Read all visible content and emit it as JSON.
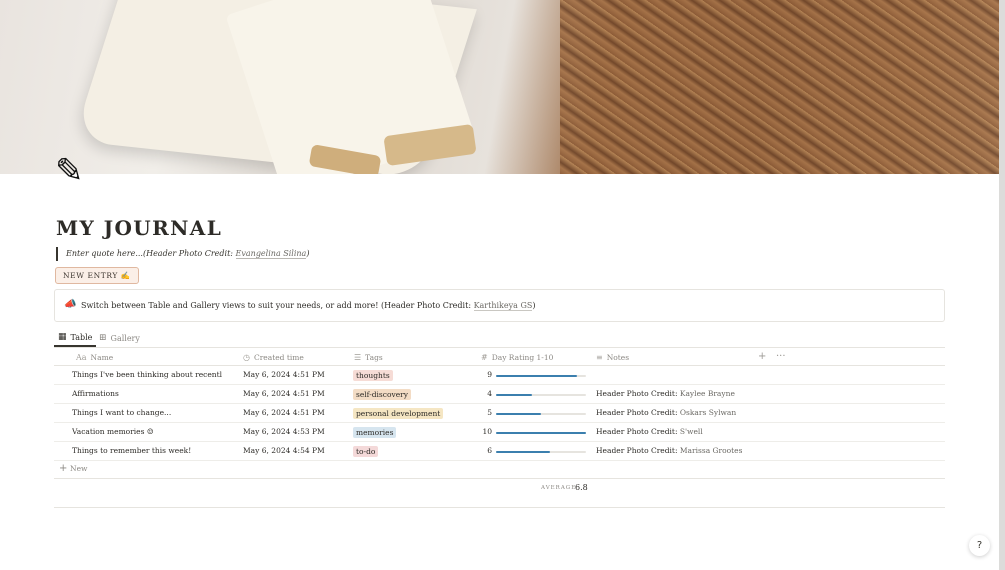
{
  "page": {
    "icon": "pencil-icon",
    "title": "MY JOURNAL",
    "quote_text": "Enter quote here...(Header Photo Credit: ",
    "quote_author": "Evangelina Silina",
    "quote_end": ")",
    "new_entry_label": "NEW ENTRY ✍"
  },
  "callout": {
    "icon": "megaphone-icon",
    "text": "Switch between Table and Gallery views to suit your needs, or add more! (Header Photo Credit: ",
    "credit": "Karthikeya GS",
    "end": ")"
  },
  "views": [
    {
      "label": "Table",
      "icon": "table-icon",
      "active": true
    },
    {
      "label": "Gallery",
      "icon": "gallery-icon",
      "active": false
    }
  ],
  "columns": [
    {
      "label": "Name",
      "icon": "text-icon"
    },
    {
      "label": "Created time",
      "icon": "clock-icon"
    },
    {
      "label": "Tags",
      "icon": "list-icon"
    },
    {
      "label": "Day Rating 1-10",
      "icon": "hash-icon"
    },
    {
      "label": "Notes",
      "icon": "lines-icon"
    }
  ],
  "rows": [
    {
      "name": "Things I've been thinking about recently...",
      "created": "May 6, 2024 4:51 PM",
      "tag": "thoughts",
      "tag_color": "#f6dcd6",
      "rating": 9,
      "notes_prefix": "",
      "notes_author": ""
    },
    {
      "name": "Affirmations",
      "created": "May 6, 2024 4:51 PM",
      "tag": "self-discovery",
      "tag_color": "#f3dcc5",
      "rating": 4,
      "notes_prefix": "Header Photo Credit: ",
      "notes_author": "Kaylee Brayne"
    },
    {
      "name": "Things I want to change...",
      "created": "May 6, 2024 4:51 PM",
      "tag": "personal development",
      "tag_color": "#f5e6c3",
      "rating": 5,
      "notes_prefix": "Header Photo Credit: ",
      "notes_author": "Oskars Sylwan"
    },
    {
      "name": "Vacation memories ☺",
      "created": "May 6, 2024 4:53 PM",
      "tag": "memories",
      "tag_color": "#d6e5ef",
      "rating": 10,
      "notes_prefix": "Header Photo Credit: ",
      "notes_author": "S'well"
    },
    {
      "name": "Things to remember this week!",
      "created": "May 6, 2024 4:54 PM",
      "tag": "to-do",
      "tag_color": "#f4d9d9",
      "rating": 6,
      "notes_prefix": "Header Photo Credit: ",
      "notes_author": "Marissa Grootes"
    }
  ],
  "new_row_label": "New",
  "footer": {
    "avg_label": "AVERAGE",
    "avg_value": "6.8"
  },
  "help_label": "?",
  "colors": {
    "accent_bar": "#3b7fae",
    "new_entry_bg": "#fbefe7"
  }
}
